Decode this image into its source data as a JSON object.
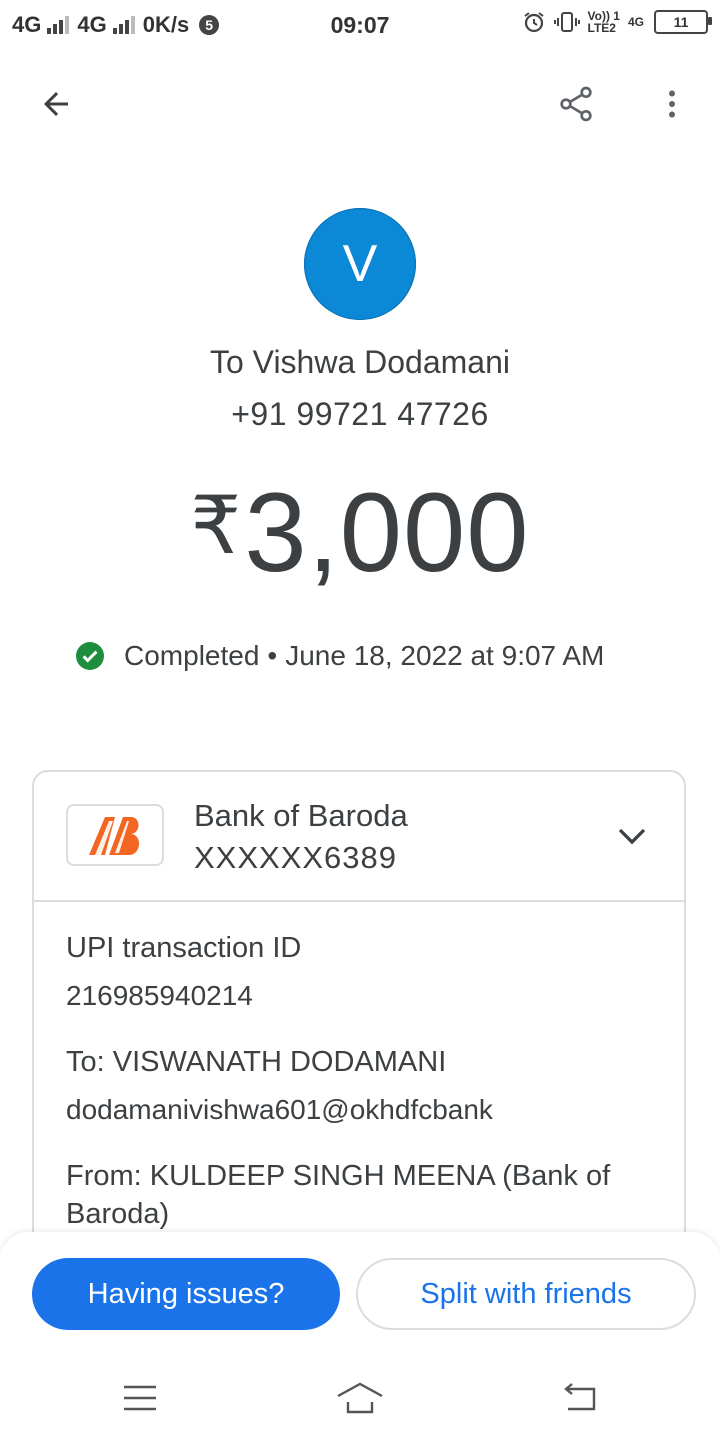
{
  "status_bar": {
    "net1": "4G",
    "net2": "4G",
    "speed": "0K/s",
    "notif_count": "5",
    "time": "09:07",
    "volte": "Vo)) 1",
    "lte2": "LTE2",
    "net3": "4G",
    "battery": "11"
  },
  "recipient": {
    "initial": "V",
    "name": "To Vishwa Dodamani",
    "phone": "+91 99721 47726"
  },
  "payment": {
    "currency": "₹",
    "amount": "3,000",
    "status": "Completed",
    "separator": "•",
    "datetime": "June 18, 2022 at 9:07 AM"
  },
  "bank": {
    "name": "Bank of Baroda",
    "account": "XXXXXX6389"
  },
  "details": {
    "upi_label": "UPI transaction ID",
    "upi_value": "216985940214",
    "to_label": "To: VISWANATH DODAMANI",
    "to_value": "dodamanivishwa601@okhdfcbank",
    "from_line1": "From: KULDEEP SINGH MEENA (Bank of",
    "from_line2": "Baroda)"
  },
  "actions": {
    "issues": "Having issues?",
    "split": "Split with friends"
  },
  "colors": {
    "avatar": "#0b88d6",
    "primary": "#1a73e8",
    "success": "#1e8e3e",
    "bank_orange": "#f26522"
  }
}
